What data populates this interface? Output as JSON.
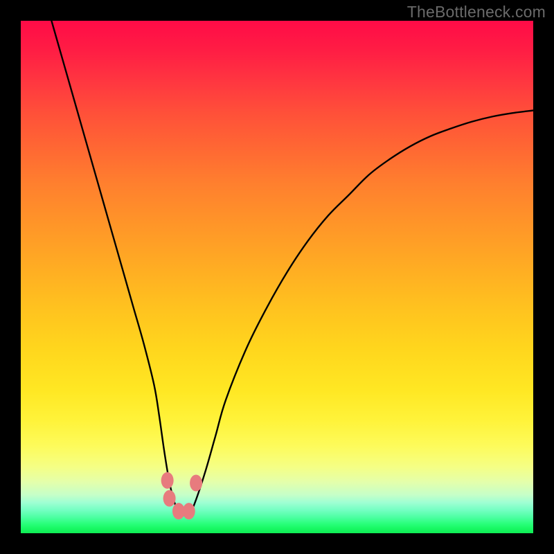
{
  "watermark": "TheBottleneck.com",
  "colors": {
    "background": "#000000",
    "curve": "#000000",
    "marker_fill": "#e77b7e",
    "marker_stroke": "#e77b7e",
    "gradient_top": "#ff0b47",
    "gradient_mid": "#ffe723",
    "gradient_bottom": "#0feb54"
  },
  "chart_data": {
    "type": "line",
    "title": "",
    "xlabel": "",
    "ylabel": "",
    "xlim": [
      0,
      100
    ],
    "ylim": [
      0,
      100
    ],
    "grid": false,
    "legend": false,
    "annotations": [
      "TheBottleneck.com"
    ],
    "series": [
      {
        "name": "bottleneck-curve",
        "x": [
          6,
          8,
          10,
          12,
          14,
          16,
          18,
          20,
          22,
          24,
          26,
          27,
          28,
          29,
          30,
          31,
          32,
          33,
          34,
          36,
          38,
          40,
          44,
          48,
          52,
          56,
          60,
          64,
          68,
          72,
          76,
          80,
          84,
          88,
          92,
          96,
          100
        ],
        "y": [
          100,
          93,
          86,
          79,
          72,
          65,
          58,
          51,
          44,
          37,
          29,
          23,
          16,
          10,
          6,
          4,
          3.5,
          4,
          6,
          12,
          19,
          26,
          36,
          44,
          51,
          57,
          62,
          66,
          70,
          73,
          75.5,
          77.5,
          79,
          80.3,
          81.3,
          82,
          82.5
        ]
      }
    ],
    "markers": [
      {
        "x": 28.6,
        "y": 10.3
      },
      {
        "x": 29.0,
        "y": 6.8
      },
      {
        "x": 30.8,
        "y": 4.3
      },
      {
        "x": 32.8,
        "y": 4.3
      },
      {
        "x": 34.2,
        "y": 9.8
      }
    ]
  }
}
